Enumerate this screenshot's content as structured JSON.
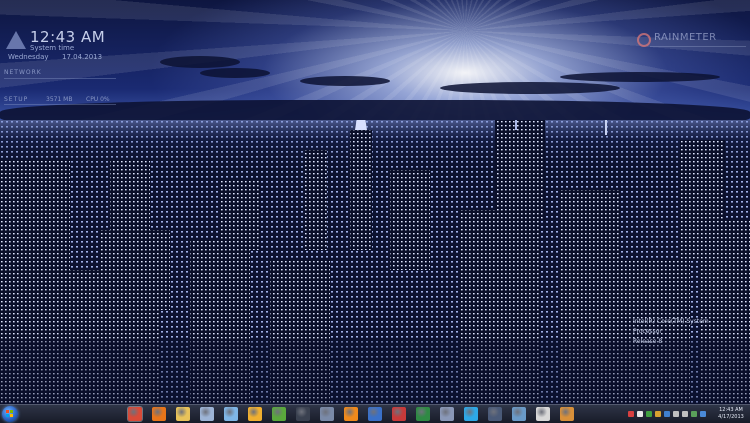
{
  "clock_widget": {
    "time": "12:43 AM",
    "subtitle": "System time",
    "day": "Wednesday",
    "date": "17.04.2013"
  },
  "network_widget": {
    "label": "NETWORK"
  },
  "system_widget": {
    "label": "SETUP",
    "memory": "3571 MB",
    "cpu": "CPU 0%"
  },
  "rt_widget": {
    "text": "RAINMETER"
  },
  "info_widget": {
    "lines": [
      "Intel(R) Core(TM) System",
      "Processor",
      "Release 8"
    ]
  },
  "taskbar": {
    "apps": [
      {
        "name": "chrome",
        "color": "#d94a38",
        "active": true
      },
      {
        "name": "firefox",
        "color": "#e8751a",
        "active": false
      },
      {
        "name": "explorer",
        "color": "#e8c35a",
        "active": false
      },
      {
        "name": "media-player",
        "color": "#9db4d6",
        "active": false
      },
      {
        "name": "notepad",
        "color": "#7fb6e6",
        "active": false
      },
      {
        "name": "winamp",
        "color": "#f0b030",
        "active": false
      },
      {
        "name": "utorrent",
        "color": "#5aa83c",
        "active": false
      },
      {
        "name": "steam",
        "color": "#3a4150",
        "active": false
      },
      {
        "name": "drop",
        "color": "#7a8aa8",
        "active": false
      },
      {
        "name": "vlc",
        "color": "#f08a1c",
        "active": false
      },
      {
        "name": "mail",
        "color": "#3a70c8",
        "active": false
      },
      {
        "name": "tools",
        "color": "#c83a3a",
        "active": false
      },
      {
        "name": "excel",
        "color": "#2f8a44",
        "active": false
      },
      {
        "name": "computer",
        "color": "#8a98b8",
        "active": false
      },
      {
        "name": "skype",
        "color": "#2ea8e6",
        "active": false
      },
      {
        "name": "keyboard",
        "color": "#4a5a78",
        "active": false
      },
      {
        "name": "network",
        "color": "#6a9ac8",
        "active": false
      },
      {
        "name": "chip",
        "color": "#d8d8d8",
        "active": false
      },
      {
        "name": "paint",
        "color": "#d8903a",
        "active": false
      }
    ],
    "tray_colors": [
      "#d84040",
      "#e8e8e8",
      "#40a040",
      "#d8a030",
      "#4080d0",
      "#c0c0c0",
      "#c0c0c0",
      "#5aa05a",
      "#4a8ad8"
    ],
    "time": "12:43 AM",
    "date": "4/17/2013"
  }
}
